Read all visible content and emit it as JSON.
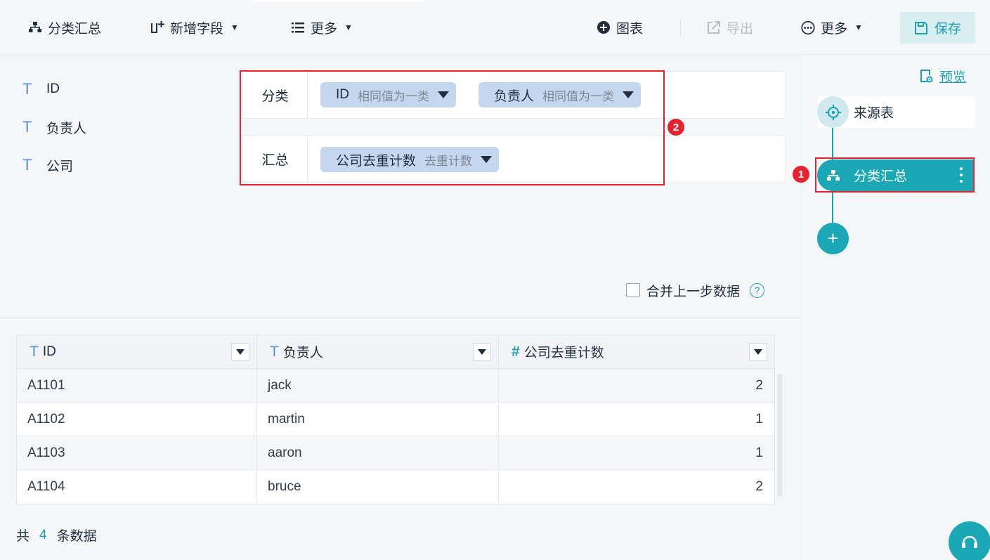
{
  "toolbar": {
    "left": [
      {
        "label": "分类汇总",
        "icon": "group-summary-icon"
      },
      {
        "label": "新增字段",
        "icon": "add-column-icon"
      },
      {
        "label": "更多",
        "icon": "list-icon"
      }
    ],
    "right": {
      "chart": "图表",
      "export": "导出",
      "more": "更多",
      "save": "保存"
    }
  },
  "fields": [
    {
      "name": "ID",
      "type_glyph": "T"
    },
    {
      "name": "负责人",
      "type_glyph": "T"
    },
    {
      "name": "公司",
      "type_glyph": "T"
    }
  ],
  "config": {
    "category_label": "分类",
    "category_chips": [
      {
        "name": "ID",
        "mode": "相同值为一类"
      },
      {
        "name": "负责人",
        "mode": "相同值为一类"
      }
    ],
    "summary_label": "汇总",
    "summary_chips": [
      {
        "name": "公司去重计数",
        "mode": "去重计数"
      }
    ],
    "badge_2": "2"
  },
  "merge": {
    "label": "合并上一步数据",
    "checked": false,
    "help": "?"
  },
  "table": {
    "columns": [
      {
        "label": "ID",
        "type_glyph": "T"
      },
      {
        "label": "负责人",
        "type_glyph": "T"
      },
      {
        "label": "公司去重计数",
        "type_glyph": "#"
      }
    ],
    "rows": [
      [
        "A1101",
        "jack",
        "2"
      ],
      [
        "A1102",
        "martin",
        "1"
      ],
      [
        "A1103",
        "aaron",
        "1"
      ],
      [
        "A1104",
        "bruce",
        "2"
      ]
    ]
  },
  "total": {
    "prefix": "共",
    "count": "4",
    "suffix": "条数据"
  },
  "right_panel": {
    "preview": "预览",
    "source_node": "来源表",
    "category_node": "分类汇总",
    "badge_1": "1",
    "add": "+"
  },
  "colors": {
    "accent": "#1aa8b6",
    "highlight": "#e5222f",
    "chip": "#c5d6ef"
  }
}
